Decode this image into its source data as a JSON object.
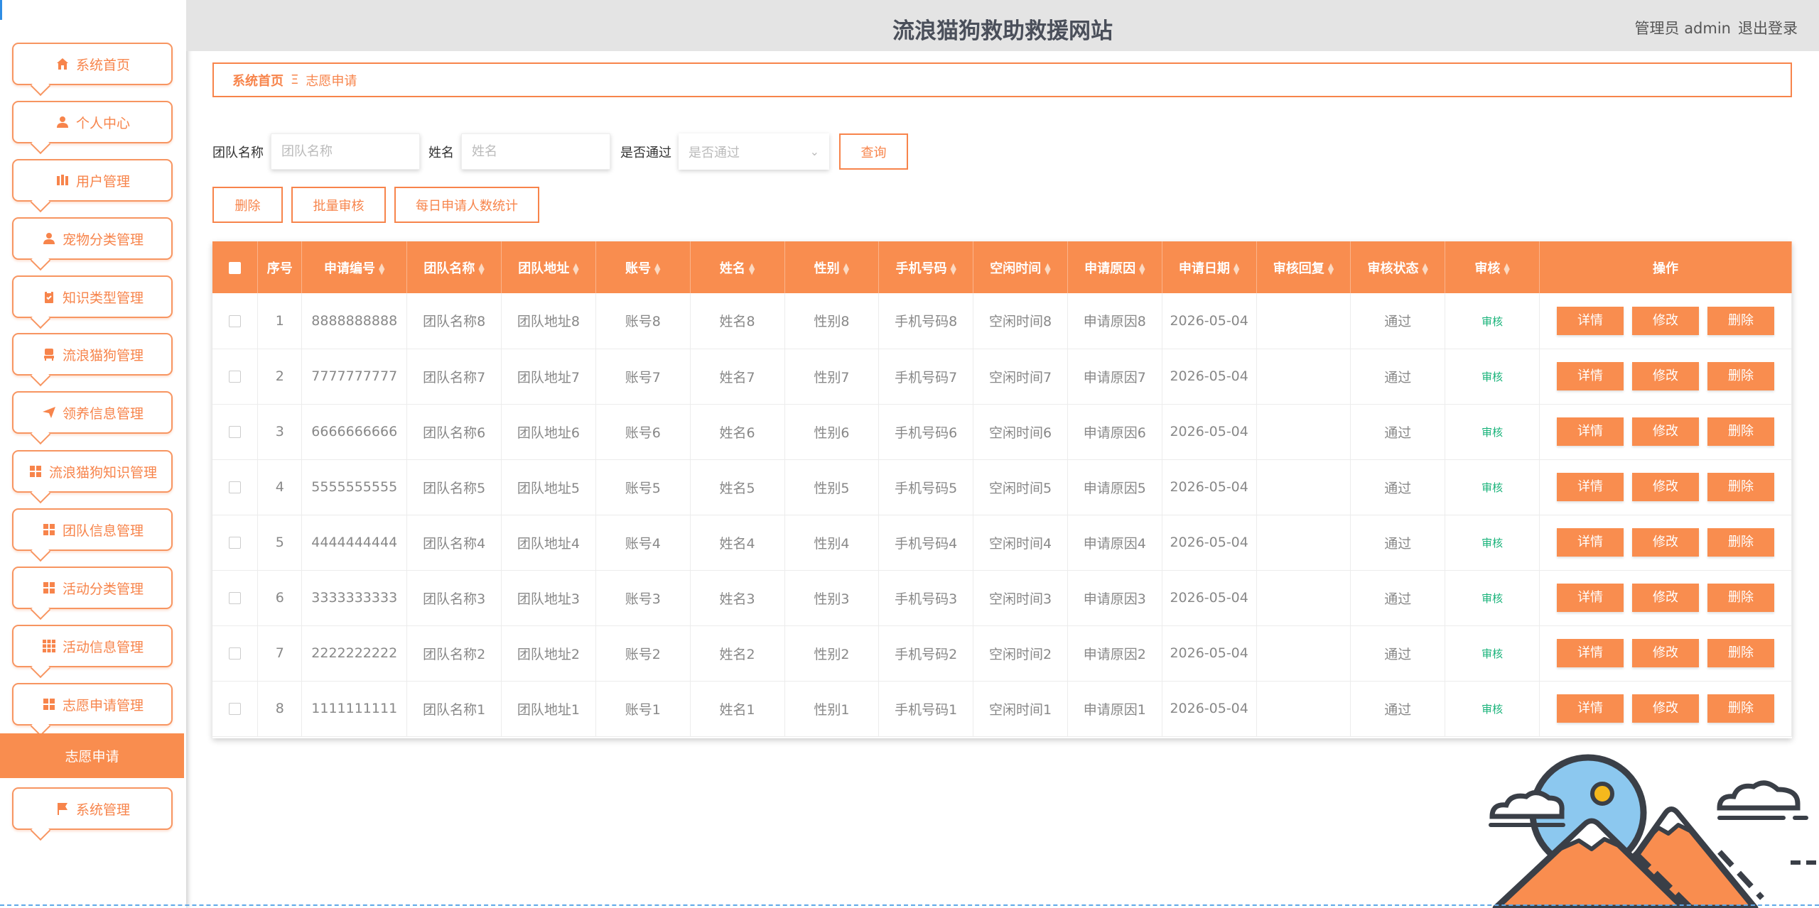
{
  "header": {
    "title": "流浪猫狗救助救援网站",
    "user_label": "管理员 admin",
    "logout": "退出登录"
  },
  "sidebar": {
    "items": [
      {
        "label": "系统首页",
        "icon": "home-icon"
      },
      {
        "label": "个人中心",
        "icon": "user-icon"
      },
      {
        "label": "用户管理",
        "icon": "users-icon"
      },
      {
        "label": "宠物分类管理",
        "icon": "user-icon"
      },
      {
        "label": "知识类型管理",
        "icon": "clipboard-icon"
      },
      {
        "label": "流浪猫狗管理",
        "icon": "chair-icon"
      },
      {
        "label": "领养信息管理",
        "icon": "send-icon"
      },
      {
        "label": "流浪猫狗知识管理",
        "icon": "grid-icon"
      },
      {
        "label": "团队信息管理",
        "icon": "grid-icon"
      },
      {
        "label": "活动分类管理",
        "icon": "grid-icon"
      },
      {
        "label": "活动信息管理",
        "icon": "grid9-icon"
      },
      {
        "label": "志愿申请管理",
        "icon": "grid-icon"
      },
      {
        "label": "系统管理",
        "icon": "flag-icon"
      }
    ],
    "active_sub": "志愿申请"
  },
  "breadcrumb": {
    "home": "系统首页",
    "separator": "Ξ",
    "current": "志愿申请"
  },
  "search": {
    "team_label": "团队名称",
    "team_placeholder": "团队名称",
    "name_label": "姓名",
    "name_placeholder": "姓名",
    "pass_label": "是否通过",
    "pass_placeholder": "是否通过",
    "query_button": "查询"
  },
  "actions": {
    "delete": "删除",
    "batch_audit": "批量审核",
    "daily_stats": "每日申请人数统计"
  },
  "table": {
    "columns": [
      "序号",
      "申请编号",
      "团队名称",
      "团队地址",
      "账号",
      "姓名",
      "性别",
      "手机号码",
      "空闲时间",
      "申请原因",
      "申请日期",
      "审核回复",
      "审核状态",
      "审核",
      "操作"
    ],
    "rows": [
      {
        "no": "1",
        "code": "8888888888",
        "team": "团队名称8",
        "address": "团队地址8",
        "account": "账号8",
        "name": "姓名8",
        "gender": "性别8",
        "phone": "手机号码8",
        "free": "空闲时间8",
        "reason": "申请原因8",
        "date": "2026-05-04",
        "reply": "",
        "status": "通过",
        "audit": "审核"
      },
      {
        "no": "2",
        "code": "7777777777",
        "team": "团队名称7",
        "address": "团队地址7",
        "account": "账号7",
        "name": "姓名7",
        "gender": "性别7",
        "phone": "手机号码7",
        "free": "空闲时间7",
        "reason": "申请原因7",
        "date": "2026-05-04",
        "reply": "",
        "status": "通过",
        "audit": "审核"
      },
      {
        "no": "3",
        "code": "6666666666",
        "team": "团队名称6",
        "address": "团队地址6",
        "account": "账号6",
        "name": "姓名6",
        "gender": "性别6",
        "phone": "手机号码6",
        "free": "空闲时间6",
        "reason": "申请原因6",
        "date": "2026-05-04",
        "reply": "",
        "status": "通过",
        "audit": "审核"
      },
      {
        "no": "4",
        "code": "5555555555",
        "team": "团队名称5",
        "address": "团队地址5",
        "account": "账号5",
        "name": "姓名5",
        "gender": "性别5",
        "phone": "手机号码5",
        "free": "空闲时间5",
        "reason": "申请原因5",
        "date": "2026-05-04",
        "reply": "",
        "status": "通过",
        "audit": "审核"
      },
      {
        "no": "5",
        "code": "4444444444",
        "team": "团队名称4",
        "address": "团队地址4",
        "account": "账号4",
        "name": "姓名4",
        "gender": "性别4",
        "phone": "手机号码4",
        "free": "空闲时间4",
        "reason": "申请原因4",
        "date": "2026-05-04",
        "reply": "",
        "status": "通过",
        "audit": "审核"
      },
      {
        "no": "6",
        "code": "3333333333",
        "team": "团队名称3",
        "address": "团队地址3",
        "account": "账号3",
        "name": "姓名3",
        "gender": "性别3",
        "phone": "手机号码3",
        "free": "空闲时间3",
        "reason": "申请原因3",
        "date": "2026-05-04",
        "reply": "",
        "status": "通过",
        "audit": "审核"
      },
      {
        "no": "7",
        "code": "2222222222",
        "team": "团队名称2",
        "address": "团队地址2",
        "account": "账号2",
        "name": "姓名2",
        "gender": "性别2",
        "phone": "手机号码2",
        "free": "空闲时间2",
        "reason": "申请原因2",
        "date": "2026-05-04",
        "reply": "",
        "status": "通过",
        "audit": "审核"
      },
      {
        "no": "8",
        "code": "1111111111",
        "team": "团队名称1",
        "address": "团队地址1",
        "account": "账号1",
        "name": "姓名1",
        "gender": "性别1",
        "phone": "手机号码1",
        "free": "空闲时间1",
        "reason": "申请原因1",
        "date": "2026-05-04",
        "reply": "",
        "status": "通过",
        "audit": "审核"
      }
    ],
    "op_buttons": {
      "detail": "详情",
      "edit": "修改",
      "delete": "删除"
    }
  },
  "colors": {
    "accent": "#f98d4f",
    "accent_border": "#f7844b",
    "audit_link": "#19b37a",
    "header_bg": "#e4e4e4"
  }
}
